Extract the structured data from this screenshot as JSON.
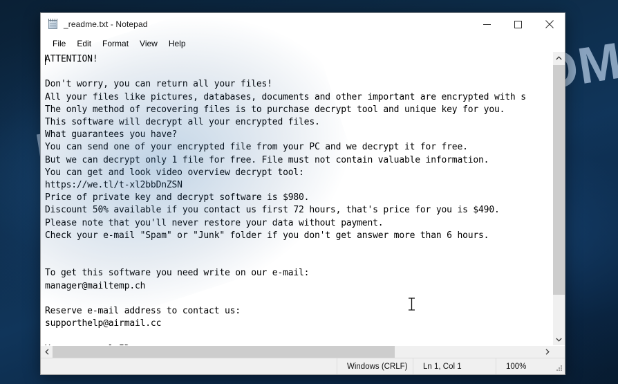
{
  "window": {
    "title": "_readme.txt - Notepad",
    "app_icon": "notepad-icon",
    "controls": {
      "minimize": "minimize-icon",
      "maximize": "maximize-icon",
      "close": "close-icon"
    }
  },
  "menubar": {
    "items": [
      {
        "label": "File"
      },
      {
        "label": "Edit"
      },
      {
        "label": "Format"
      },
      {
        "label": "View"
      },
      {
        "label": "Help"
      }
    ]
  },
  "editor": {
    "text": "ATTENTION!\n\nDon't worry, you can return all your files!\nAll your files like pictures, databases, documents and other important are encrypted with s\nThe only method of recovering files is to purchase decrypt tool and unique key for you.\nThis software will decrypt all your encrypted files.\nWhat guarantees you have?\nYou can send one of your encrypted file from your PC and we decrypt it for free.\nBut we can decrypt only 1 file for free. File must not contain valuable information.\nYou can get and look video overview decrypt tool:\nhttps://we.tl/t-xl2bbDnZSN\nPrice of private key and decrypt software is $980.\nDiscount 50% available if you contact us first 72 hours, that's price for you is $490.\nPlease note that you'll never restore your data without payment.\nCheck your e-mail \"Spam\" or \"Junk\" folder if you don't get answer more than 6 hours.\n\n\nTo get this software you need write on our e-mail:\nmanager@mailtemp.ch\n\nReserve e-mail address to contact us:\nsupporthelp@airmail.cc\n\nYour personal ID:"
  },
  "scrollbars": {
    "vertical": {
      "up_arrow": "chevron-up-icon",
      "down_arrow": "chevron-down-icon"
    },
    "horizontal": {
      "left_arrow": "chevron-left-icon",
      "right_arrow": "chevron-right-icon"
    }
  },
  "statusbar": {
    "line_ending": "Windows (CRLF)",
    "position": "Ln 1, Col 1",
    "zoom": "100%"
  },
  "desktop": {
    "watermark": "MYANTISPYWARE.COM",
    "background_color": "#0d2b47"
  }
}
